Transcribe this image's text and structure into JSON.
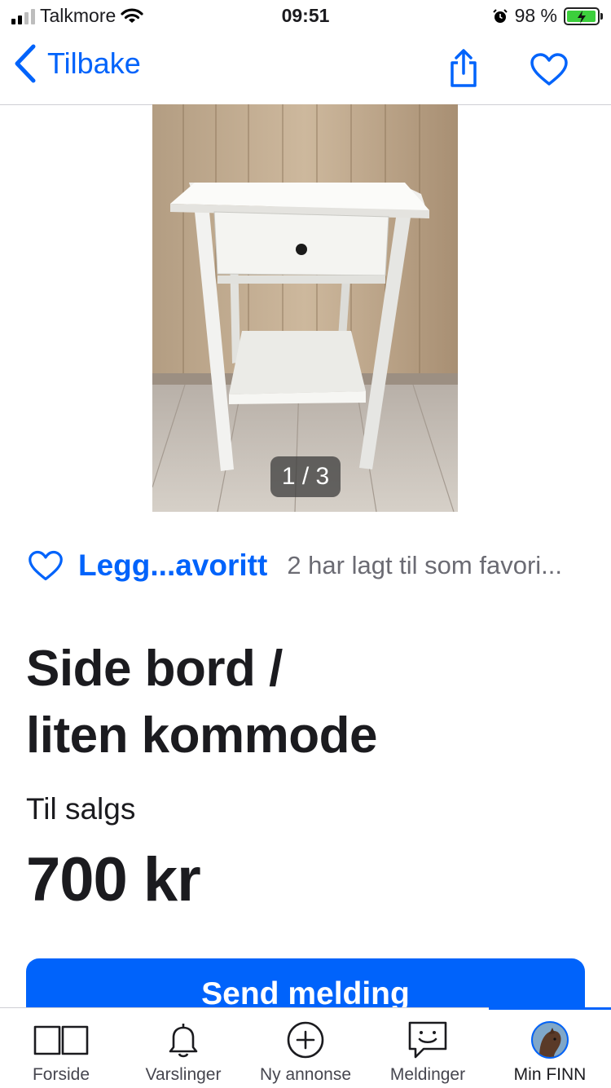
{
  "status_bar": {
    "carrier": "Talkmore",
    "time": "09:51",
    "battery_percent": "98 %",
    "battery_level": 0.98
  },
  "nav": {
    "back_label": "Tilbake",
    "share_icon": "share-icon",
    "favorite_icon": "heart-icon"
  },
  "gallery": {
    "counter": "1 / 3"
  },
  "favorite": {
    "link_label": "Legg...avoritt",
    "count_text": "2 har lagt til som favori..."
  },
  "listing": {
    "title_line1": "Side bord /",
    "title_line2": "liten kommode",
    "sale_type": "Til salgs",
    "price": "700 kr"
  },
  "actions": {
    "send_message": "Send melding"
  },
  "tabs": [
    {
      "label": "Forside",
      "icon": "book-icon"
    },
    {
      "label": "Varslinger",
      "icon": "bell-icon"
    },
    {
      "label": "Ny annonse",
      "icon": "plus-circle-icon"
    },
    {
      "label": "Meldinger",
      "icon": "chat-icon"
    },
    {
      "label": "Min FINN",
      "icon": "avatar"
    }
  ],
  "colors": {
    "accent": "#0063fb",
    "text": "#1b1b1f",
    "muted": "#6b6b73"
  }
}
